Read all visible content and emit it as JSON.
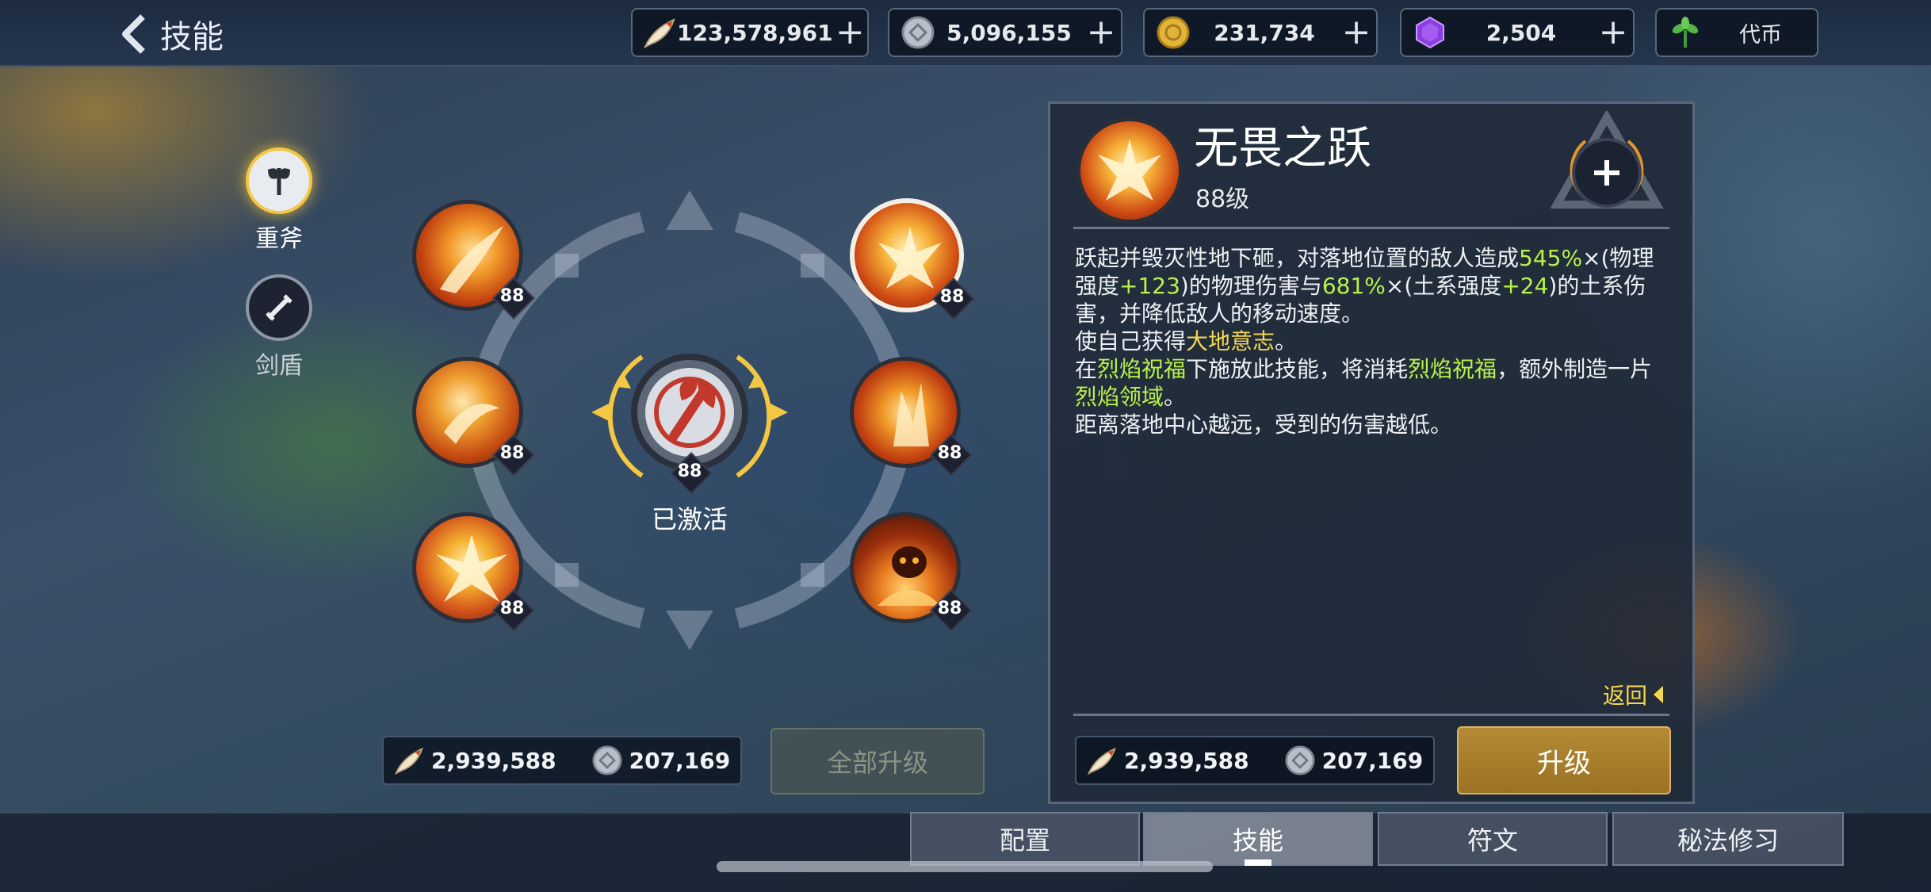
{
  "header": {
    "title": "技能"
  },
  "currencies": [
    {
      "icon": "horn-icon",
      "value": "123,578,961",
      "has_plus": true
    },
    {
      "icon": "silver-coin-icon",
      "value": "5,096,155",
      "has_plus": true
    },
    {
      "icon": "gold-coin-icon",
      "value": "231,734",
      "has_plus": true
    },
    {
      "icon": "purple-gem-icon",
      "value": "2,504",
      "has_plus": true
    },
    {
      "icon": "sprout-icon",
      "value": "代币",
      "has_plus": false
    }
  ],
  "weapons": [
    {
      "label": "重斧",
      "icon": "axe-icon",
      "selected": true
    },
    {
      "label": "剑盾",
      "icon": "sword-shield-icon",
      "selected": false
    }
  ],
  "skills": {
    "left": [
      {
        "level": "88",
        "icon": "flame-slash-skill-icon"
      },
      {
        "level": "88",
        "icon": "flame-swing-skill-icon"
      },
      {
        "level": "88",
        "icon": "flame-burst-skill-icon"
      }
    ],
    "right": [
      {
        "level": "88",
        "icon": "fearless-leap-skill-icon",
        "selected": true
      },
      {
        "level": "88",
        "icon": "flame-crystal-skill-icon"
      },
      {
        "level": "88",
        "icon": "flame-spirit-skill-icon"
      }
    ],
    "center": {
      "level": "88",
      "status": "已激活",
      "icon": "axe-mastery-icon"
    }
  },
  "bottom_left": {
    "costs": [
      {
        "icon": "horn-icon",
        "value": "2,939,588"
      },
      {
        "icon": "silver-coin-icon",
        "value": "207,169"
      }
    ],
    "upgrade_all_label": "全部升级"
  },
  "detail": {
    "skill_name": "无畏之跃",
    "level_text": "88级",
    "description": {
      "line1_a": "跃起并毁灭性地下砸，对落地位置的敌人造成",
      "v1": "545%",
      "line1_b": "×(物理强度",
      "v2": "+123",
      "line1_c": ")的物理伤害与",
      "v3": "681%",
      "line1_d": "×(土系强度",
      "v4": "+24",
      "line1_e": ")的土系伤害，并降低敌人的移动速度。",
      "line2_a": "使自己获得",
      "k1": "大地意志",
      "line2_b": "。",
      "line3_a": "在",
      "k2": "烈焰祝福",
      "line3_b": "下施放此技能，将消耗",
      "k3": "烈焰祝福",
      "line3_c": "，额外制造一片",
      "k4": "烈焰领域",
      "line3_d": "。",
      "line4": "距离落地中心越远，受到的伤害越低。"
    },
    "back_label": "返回",
    "costs": [
      {
        "icon": "horn-icon",
        "value": "2,939,588"
      },
      {
        "icon": "silver-coin-icon",
        "value": "207,169"
      }
    ],
    "upgrade_label": "升级"
  },
  "tabs": [
    {
      "label": "配置",
      "active": false
    },
    {
      "label": "技能",
      "active": true
    },
    {
      "label": "符文",
      "active": false
    },
    {
      "label": "秘法修习",
      "active": false
    }
  ],
  "colors": {
    "highlight_green": "#b8f24a",
    "highlight_yellow": "#f4d850",
    "upgrade_button": "#a97e2a"
  }
}
